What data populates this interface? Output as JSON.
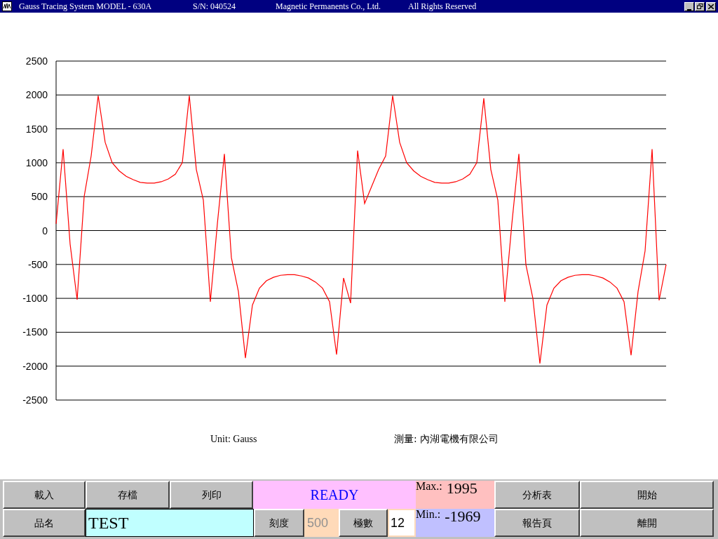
{
  "window": {
    "title_parts": [
      "Gauss Tracing System   MODEL - 630A",
      "S/N: 040524",
      "Magnetic Permanents Co., Ltd.",
      "All Rights Reserved"
    ]
  },
  "chart": {
    "chart_data": {
      "type": "line",
      "grid": true,
      "ylim": [
        -2500,
        2500
      ],
      "yticks": [
        2500,
        2000,
        1500,
        1000,
        500,
        0,
        -500,
        -1000,
        -1500,
        -2000,
        -2500
      ],
      "categories": [
        null,
        null,
        null,
        null,
        null,
        null,
        null,
        null,
        null,
        null,
        null,
        null,
        null,
        null,
        null,
        null,
        null,
        null,
        null,
        null,
        null,
        null,
        null,
        null,
        null,
        null,
        null,
        null,
        null,
        null,
        null,
        null,
        null,
        null,
        null,
        null,
        null,
        null,
        null,
        null,
        null,
        null,
        null,
        null,
        null,
        null,
        null,
        null,
        null,
        null,
        null,
        null,
        null,
        null,
        null,
        null,
        null,
        null,
        null,
        null,
        null,
        null,
        null,
        null,
        null,
        null,
        null,
        null,
        null,
        null,
        null,
        null,
        null,
        null,
        null,
        null,
        null,
        null,
        null,
        null,
        null,
        null,
        null,
        null,
        null,
        null,
        null,
        null
      ],
      "values": [
        100,
        1200,
        -200,
        -1020,
        500,
        1100,
        1990,
        1300,
        1000,
        880,
        800,
        750,
        710,
        700,
        700,
        720,
        760,
        830,
        1000,
        1990,
        900,
        450,
        -1050,
        100,
        1130,
        -400,
        -900,
        -1880,
        -1100,
        -850,
        -740,
        -690,
        -660,
        -650,
        -650,
        -670,
        -700,
        -760,
        -850,
        -1050,
        -1830,
        -700,
        -1070,
        1180,
        400,
        650,
        900,
        1100,
        1990,
        1300,
        1000,
        880,
        800,
        750,
        710,
        700,
        700,
        720,
        760,
        830,
        1000,
        1950,
        900,
        450,
        -1050,
        100,
        1130,
        -500,
        -1000,
        -1960,
        -1100,
        -850,
        -740,
        -690,
        -660,
        -650,
        -650,
        -670,
        -700,
        -760,
        -850,
        -1050,
        -1840,
        -900,
        -300,
        1200,
        -1030,
        -500
      ]
    }
  },
  "unit_label": "Unit: Gauss",
  "measure_label": "測量: 內湖電機有限公司",
  "buttons_row1": [
    "載入",
    "存檔",
    "列印"
  ],
  "status": "READY",
  "max": {
    "label": "Max.:",
    "value": "1995"
  },
  "min": {
    "label": "Min.:",
    "value": "-1969"
  },
  "buttons_right_row1": [
    "分析表",
    "開始"
  ],
  "name_button": "品名",
  "name_field": "TEST",
  "scale_button": "刻度",
  "scale_field": {
    "value": "500",
    "disabled": true
  },
  "poles_button": "極數",
  "poles_field": {
    "value": "12",
    "disabled": false
  },
  "buttons_right_row2": [
    "報告頁",
    "離開"
  ]
}
